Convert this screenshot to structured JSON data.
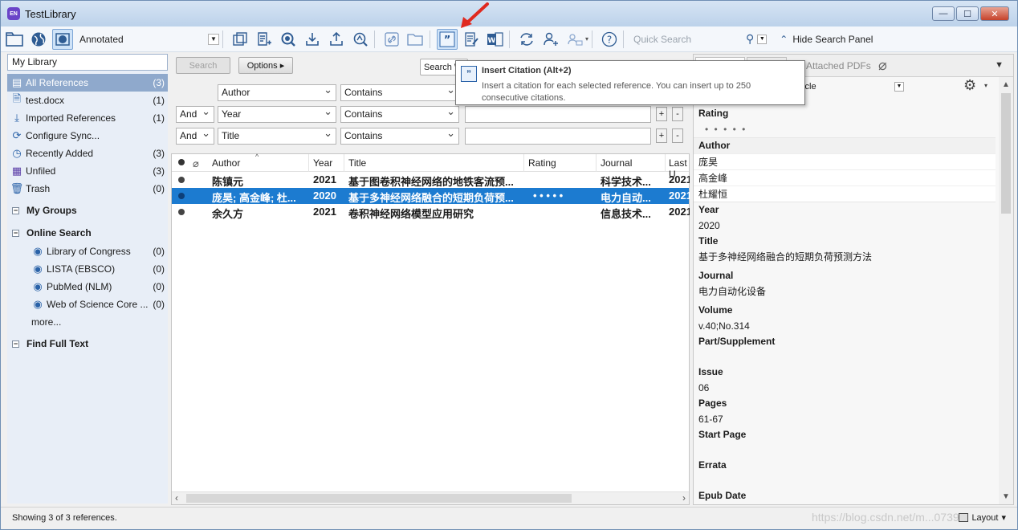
{
  "window": {
    "title": "TestLibrary",
    "app_icon_text": "EN",
    "minimize": "—",
    "maximize": "☐",
    "close": "✕"
  },
  "toolbar": {
    "style_name": "Annotated",
    "quick_search_placeholder": "Quick Search",
    "hide_search_panel": "Hide Search Panel"
  },
  "tooltip": {
    "title": "Insert Citation (Alt+2)",
    "body": "Insert a citation for each selected reference. You can insert up to 250 consecutive citations."
  },
  "sidebar": {
    "library_label": "My Library",
    "items": [
      {
        "label": "All References",
        "count": "(3)"
      },
      {
        "label": "test.docx",
        "count": "(1)"
      },
      {
        "label": "Imported References",
        "count": "(1)"
      },
      {
        "label": "Configure Sync...",
        "count": ""
      },
      {
        "label": "Recently Added",
        "count": "(3)"
      },
      {
        "label": "Unfiled",
        "count": "(3)"
      },
      {
        "label": "Trash",
        "count": "(0)"
      }
    ],
    "my_groups": "My Groups",
    "online_search": "Online Search",
    "online_items": [
      {
        "label": "Library of Congress",
        "count": "(0)"
      },
      {
        "label": "LISTA (EBSCO)",
        "count": "(0)"
      },
      {
        "label": "PubMed (NLM)",
        "count": "(0)"
      },
      {
        "label": "Web of Science Core ...",
        "count": "(0)"
      }
    ],
    "more": "more...",
    "find_full_text": "Find Full Text"
  },
  "search": {
    "search_button": "Search",
    "options_button": "Options ▸",
    "search_whole": "Search W",
    "rows": [
      {
        "bool": "",
        "field": "Author",
        "op": "Contains"
      },
      {
        "bool": "And",
        "field": "Year",
        "op": "Contains"
      },
      {
        "bool": "And",
        "field": "Title",
        "op": "Contains"
      }
    ],
    "plus": "+",
    "minus": "-"
  },
  "table": {
    "headers": {
      "author": "Author",
      "year": "Year",
      "title": "Title",
      "rating": "Rating",
      "journal": "Journal",
      "last": "Last U"
    },
    "rows": [
      {
        "author": "陈镇元",
        "year": "2021",
        "title": "基于图卷积神经网络的地铁客流预...",
        "rating": "",
        "journal": "科学技术...",
        "last": "2021"
      },
      {
        "author": "庞昊; 高金峰; 杜...",
        "year": "2020",
        "title": "基于多神经网络融合的短期负荷预...",
        "rating": "• • • • •",
        "journal": "电力自动...",
        "last": "2021"
      },
      {
        "author": "余久方",
        "year": "2021",
        "title": "卷积神经网络模型应用研究",
        "rating": "",
        "journal": "信息技术...",
        "last": "2021"
      }
    ]
  },
  "detail": {
    "attached_pdfs": "Attached PDFs",
    "ref_type": "Article",
    "fields": {
      "rating_label": "Rating",
      "rating_value": "• • • • •",
      "author_label": "Author",
      "authors": [
        "庞昊",
        "高金峰",
        "杜耀恒"
      ],
      "year_label": "Year",
      "year": "2020",
      "title_label": "Title",
      "title": "基于多神经网络融合的短期负荷预测方法",
      "journal_label": "Journal",
      "journal": "电力自动化设备",
      "volume_label": "Volume",
      "volume": "v.40;No.314",
      "part_label": "Part/Supplement",
      "part": "",
      "issue_label": "Issue",
      "issue": "06",
      "pages_label": "Pages",
      "pages": "61-67",
      "start_page_label": "Start Page",
      "start_page": "",
      "errata_label": "Errata",
      "errata": "",
      "epub_label": "Epub Date"
    }
  },
  "status": {
    "text": "Showing 3 of 3 references.",
    "layout": "Layout",
    "watermark": "https://blog.csdn.net/m...0739"
  },
  "colors": {
    "selected_row": "#1c7bd0",
    "selected_group": "#8fa9cc",
    "annotation_arrow": "#e0291f"
  }
}
